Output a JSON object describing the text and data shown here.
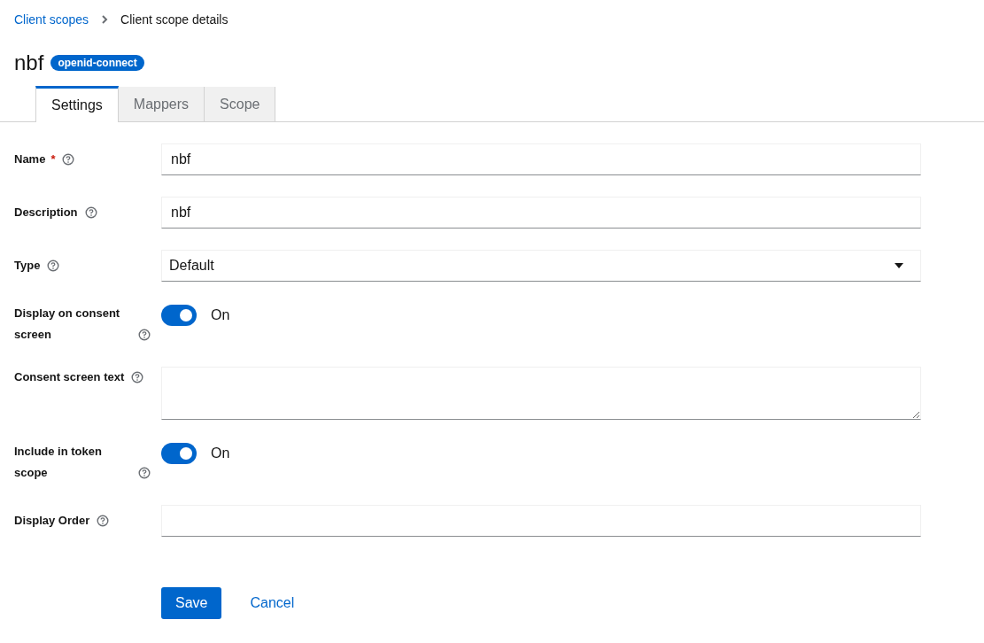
{
  "breadcrumb": [
    {
      "label": "Client scopes",
      "link": true
    },
    {
      "label": "Client scope details",
      "link": false
    }
  ],
  "title": "nbf",
  "badge": "openid-connect",
  "tabs": [
    {
      "label": "Settings",
      "selected": true
    },
    {
      "label": "Mappers",
      "selected": false
    },
    {
      "label": "Scope",
      "selected": false
    }
  ],
  "fields": [
    {
      "kind": "text",
      "label": "Name",
      "required_mark": "*",
      "value": "nbf"
    },
    {
      "kind": "text",
      "label": "Description",
      "value": "nbf"
    },
    {
      "kind": "select",
      "label": "Type",
      "value": "Default"
    },
    {
      "kind": "switch",
      "label": "Display on consent screen",
      "on": true,
      "state_label": "On"
    },
    {
      "kind": "textarea",
      "label": "Consent screen text"
    },
    {
      "kind": "switch",
      "label": "Include in token scope",
      "on": true,
      "state_label": "On"
    },
    {
      "kind": "text",
      "label": "Display Order"
    }
  ],
  "buttons": {
    "save": "Save",
    "cancel": "Cancel"
  }
}
